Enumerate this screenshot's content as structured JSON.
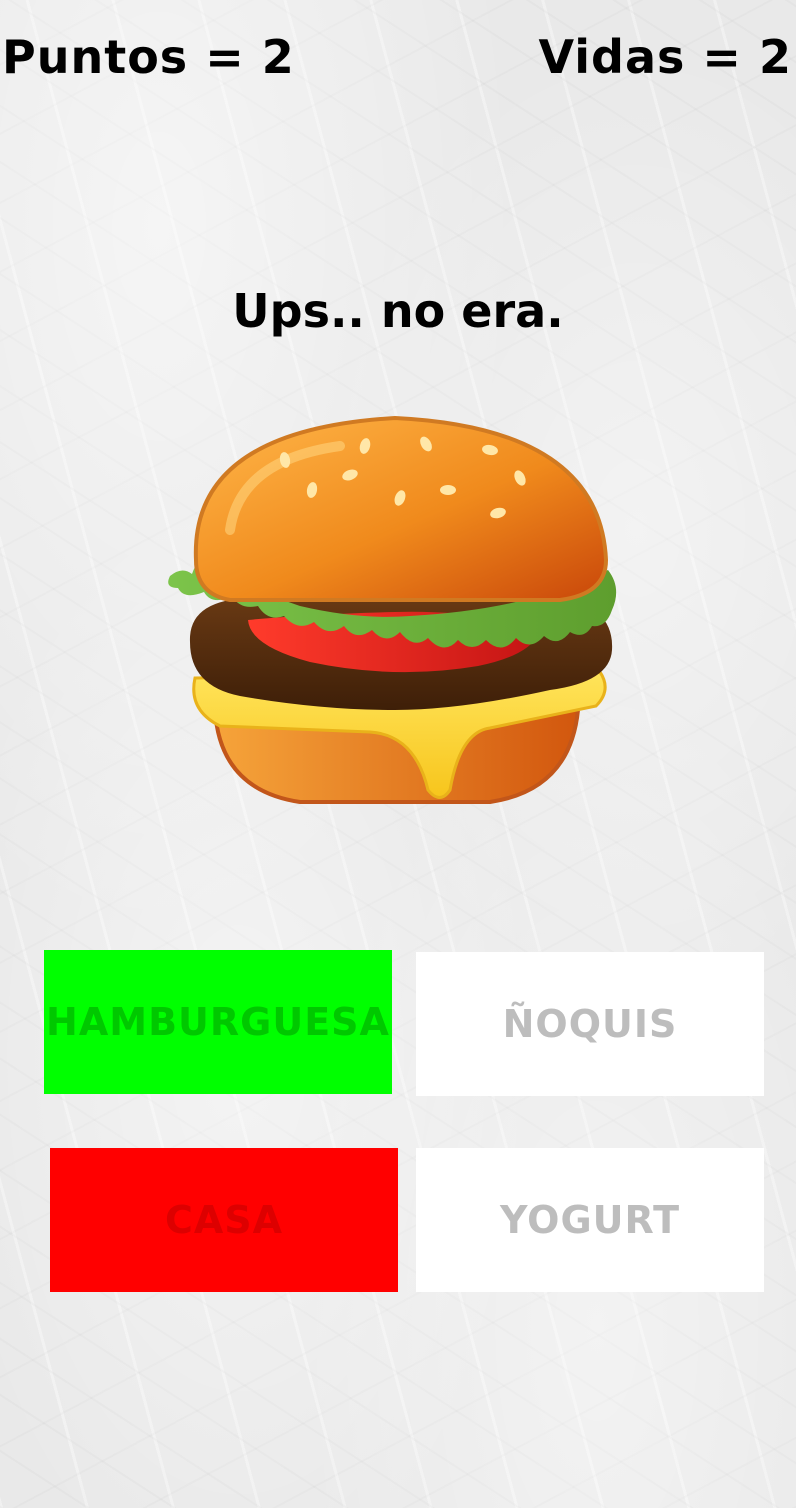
{
  "hud": {
    "score_text": "Puntos = 2",
    "lives_text": "Vidas = 2"
  },
  "feedback": {
    "message": "Ups.. no era."
  },
  "question": {
    "image_icon": "hamburger-emoji-icon"
  },
  "answers": [
    {
      "label": "HAMBURGUESA",
      "state": "correct",
      "background": "#00FF00",
      "text_color": "#00C800"
    },
    {
      "label": "ÑOQUIS",
      "state": "neutral",
      "background": "#FFFFFF",
      "text_color": "#BDBDBD"
    },
    {
      "label": "CASA",
      "state": "wrong",
      "background": "#FF0000",
      "text_color": "#DD0000"
    },
    {
      "label": "YOGURT",
      "state": "neutral",
      "background": "#FFFFFF",
      "text_color": "#BDBDBD"
    }
  ]
}
